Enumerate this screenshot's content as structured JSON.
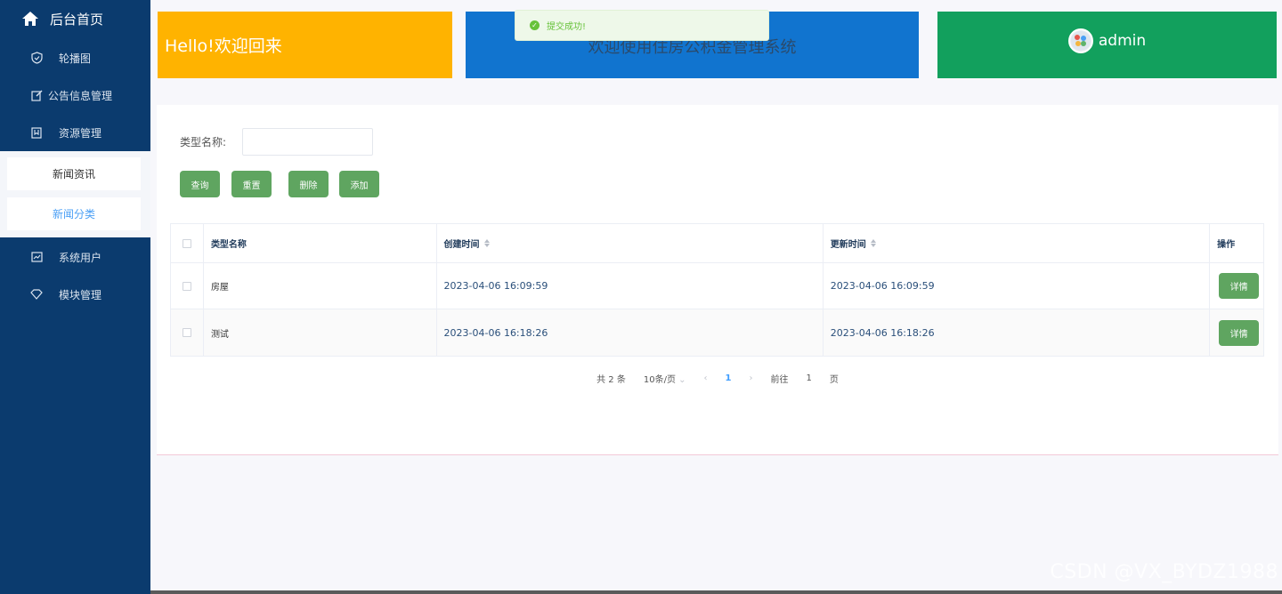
{
  "sidebar": {
    "home_label": "后台首页",
    "items": [
      {
        "label": "轮播图",
        "icon": "shield-check-icon"
      },
      {
        "label": "公告信息管理",
        "icon": "edit-icon"
      },
      {
        "label": "资源管理",
        "icon": "bookmark-icon"
      },
      {
        "label": "系统用户",
        "icon": "chart-icon"
      },
      {
        "label": "模块管理",
        "icon": "diamond-icon"
      }
    ],
    "submenu": [
      {
        "label": "新闻资讯"
      },
      {
        "label": "新闻分类"
      }
    ]
  },
  "header": {
    "hello": "Hello!欢迎回来",
    "welcome": "欢迎使用住房公积金管理系统",
    "username": "admin"
  },
  "toast": {
    "message": "提交成功!"
  },
  "search": {
    "label": "类型名称:",
    "value": ""
  },
  "buttons": {
    "query": "查询",
    "reset": "重置",
    "delete": "删除",
    "add": "添加"
  },
  "table": {
    "columns": [
      "类型名称",
      "创建时间",
      "更新时间",
      "操作"
    ],
    "rows": [
      {
        "name": "房屋",
        "created": "2023-04-06 16:09:59",
        "updated": "2023-04-06 16:09:59",
        "action": "详情"
      },
      {
        "name": "测试",
        "created": "2023-04-06 16:18:26",
        "updated": "2023-04-06 16:18:26",
        "action": "详情"
      }
    ]
  },
  "pagination": {
    "total": "共 2 条",
    "page_size": "10条/页",
    "current": "1",
    "goto_label": "前往",
    "goto_value": "1",
    "page_suffix": "页"
  },
  "watermark": "CSDN @VX_BYDZ1988",
  "colors": {
    "sidebar": "#0b3b6e",
    "hello": "#ffb300",
    "welcome": "#1174cf",
    "user": "#12a05d",
    "button": "#5fa560"
  }
}
